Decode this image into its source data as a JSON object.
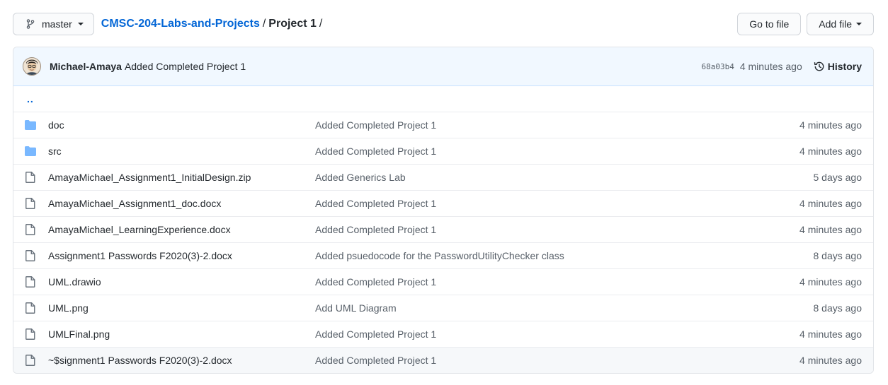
{
  "branch": {
    "label": "master"
  },
  "breadcrumb": {
    "repo": "CMSC-204-Labs-and-Projects",
    "separator": "/",
    "current": "Project 1",
    "trailing": "/"
  },
  "actions": {
    "go_to_file": "Go to file",
    "add_file": "Add file"
  },
  "latest_commit": {
    "author": "Michael-Amaya",
    "message": "Added Completed Project 1",
    "sha": "68a03b4",
    "time": "4 minutes ago",
    "history_label": "History"
  },
  "parent_dir": "..",
  "files": [
    {
      "type": "dir",
      "name": "doc",
      "message": "Added Completed Project 1",
      "age": "4 minutes ago"
    },
    {
      "type": "dir",
      "name": "src",
      "message": "Added Completed Project 1",
      "age": "4 minutes ago"
    },
    {
      "type": "file",
      "name": "AmayaMichael_Assignment1_InitialDesign.zip",
      "message": "Added Generics Lab",
      "age": "5 days ago"
    },
    {
      "type": "file",
      "name": "AmayaMichael_Assignment1_doc.docx",
      "message": "Added Completed Project 1",
      "age": "4 minutes ago"
    },
    {
      "type": "file",
      "name": "AmayaMichael_LearningExperience.docx",
      "message": "Added Completed Project 1",
      "age": "4 minutes ago"
    },
    {
      "type": "file",
      "name": "Assignment1 Passwords F2020(3)-2.docx",
      "message": "Added psuedocode for the PasswordUtilityChecker class",
      "age": "8 days ago"
    },
    {
      "type": "file",
      "name": "UML.drawio",
      "message": "Added Completed Project 1",
      "age": "4 minutes ago"
    },
    {
      "type": "file",
      "name": "UML.png",
      "message": "Add UML Diagram",
      "age": "8 days ago"
    },
    {
      "type": "file",
      "name": "UMLFinal.png",
      "message": "Added Completed Project 1",
      "age": "4 minutes ago"
    },
    {
      "type": "file",
      "name": "~$signment1 Passwords F2020(3)-2.docx",
      "message": "Added Completed Project 1",
      "age": "4 minutes ago"
    }
  ],
  "icons": {
    "folder": "folder-icon",
    "file": "file-icon",
    "branch": "git-branch-icon",
    "history": "history-icon"
  },
  "colors": {
    "link": "#0366d6",
    "folder": "#79b8ff",
    "header_bg": "#f1f8ff"
  }
}
